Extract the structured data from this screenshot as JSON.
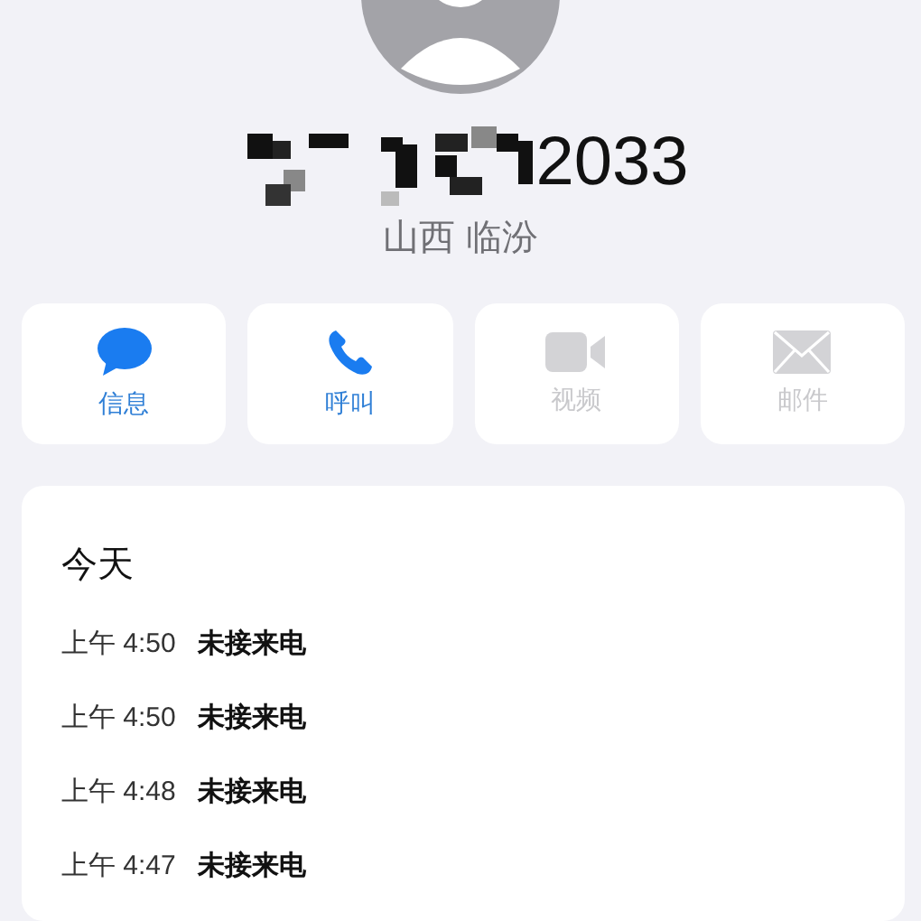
{
  "contact": {
    "number": "2033",
    "location": "山西 临汾"
  },
  "actions": [
    {
      "kind": "message",
      "label": "信息",
      "disabled": false
    },
    {
      "kind": "call",
      "label": "呼叫",
      "disabled": false
    },
    {
      "kind": "video",
      "label": "视频",
      "disabled": true
    },
    {
      "kind": "mail",
      "label": "邮件",
      "disabled": true
    }
  ],
  "history": {
    "heading": "今天",
    "entries": [
      {
        "time": "上午 4:50",
        "type": "未接来电"
      },
      {
        "time": "上午 4:50",
        "type": "未接来电"
      },
      {
        "time": "上午 4:48",
        "type": "未接来电"
      },
      {
        "time": "上午 4:47",
        "type": "未接来电"
      }
    ]
  }
}
